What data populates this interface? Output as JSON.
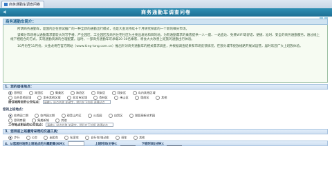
{
  "browser": {
    "tab_title": "商务通勤车调查问卷"
  },
  "header": {
    "title": "商务通勤车调查问卷"
  },
  "intro": {
    "heading": "商务通勤车简介：",
    "paragraphs": [
      "所谓商务通勤车，是国内正在尝试推广的一种全新的通勤出行模式，也是大金龙持续十个月研究探索的一个新的细分市场。",
      "该细分市场将以通勤需求量较大的写字楼、产业园区、工业园区及商务住宅社区为主要出发地和目的地，为有通勤需求的乘客提供一人一座、一站直达、免费WIFI等舒适、便捷、准时、安全的商务通勤服务，通过线上线下相结合的方式，实现通勤资源的合理配置。届时，一部商务通勤车可承载20-30名乘客，将会大大改善上班族的通勤出行体验。",
      "10月份至11月份，大金龙将在官方网站（www.king-long.com.cn）推出针对商务通勤车的相关需求调查，并根据调查结果和市场反馈情况，在部分城市投放线路开展试运营，届时欢迎广大上班族体验。"
    ]
  },
  "q1": {
    "title": "1、您的居住地点：",
    "options": [
      "思明区",
      "湖里区",
      "集美区",
      "海沧区",
      "同安区",
      "翔安区",
      "岛内其他区域",
      "岛外其他区域",
      "本市其他区域",
      "非本市区域",
      "杏林区",
      "禾山区",
      "莲前区",
      "其他"
    ],
    "selected": 0,
    "field_label": "居住地附近的公交站点：",
    "field_placeholder": "请输入 站点名称 关键字，然后在下拉框 选择站点"
  },
  "q2": {
    "title": "您的上班地点：",
    "options": [
      "软件园二期",
      "软件园三期",
      "观音山片区",
      "火炬园",
      "自贸区",
      "湖里高新技术园",
      "思明商圈",
      "集美新城",
      "其他"
    ],
    "selected": 0,
    "field_label": "工作地点附近的公交站点：",
    "field_placeholder": "请输入 站点名称 关键字，然后在下拉框 选择站点"
  },
  "q3": {
    "title": "3、您目前上班最常采用的交通工具：",
    "options": [
      "步行",
      "公交",
      "出租车",
      "私家车",
      "自行车/电动车",
      "班车",
      "其他"
    ],
    "selected": 0
  },
  "q4": {
    "title": "4、从您居住地到上班地点的大概距离(KM)：",
    "work_start_label": "上班时间(分钟)：",
    "work_end_label": "下班时间(分钟)："
  },
  "colors": {
    "header": "#1d6f94",
    "intro_background": "#f6fbf2",
    "question_bar": "#cfe0f2"
  }
}
